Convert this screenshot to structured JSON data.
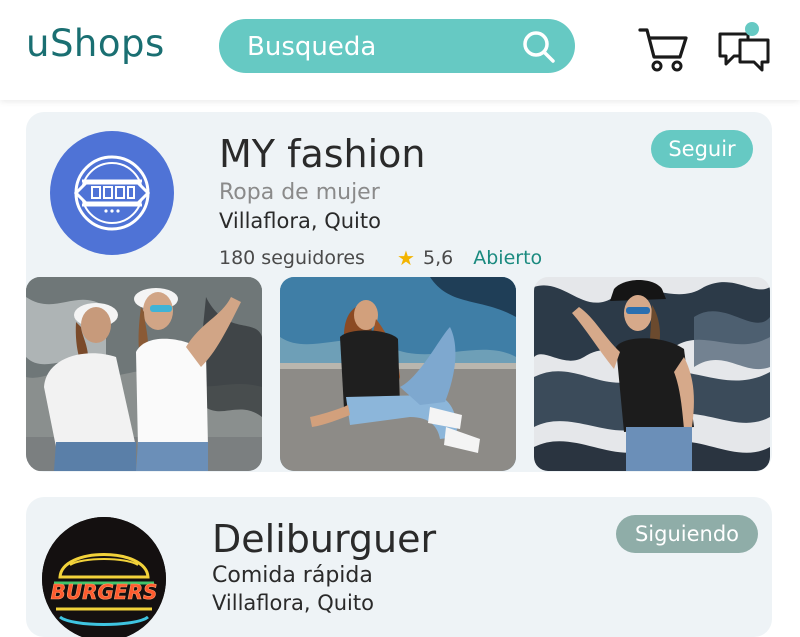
{
  "header": {
    "logo": "uShops",
    "search": {
      "placeholder": "Busqueda"
    }
  },
  "stores": [
    {
      "name": "MY fashion",
      "category": "Ropa de mujer",
      "location": "Villaflora, Quito",
      "followers": "180 seguidores",
      "rating": "5,6",
      "status": "Abierto",
      "follow_label": "Seguir"
    },
    {
      "name": "Deliburguer",
      "category": "Comida rápida",
      "location": "Villaflora, Quito",
      "follow_label": "Siguiendo",
      "logo_text": "BURGERS"
    }
  ],
  "colors": {
    "brand": "#1a6f72",
    "accent": "#66c9c3",
    "following": "#8fada8",
    "star": "#f3b400",
    "status_open": "#1a8a7f",
    "card_bg": "#eef3f6"
  },
  "icons": [
    "search-icon",
    "cart-icon",
    "chat-icon",
    "star-icon",
    "store-logo-icon"
  ]
}
